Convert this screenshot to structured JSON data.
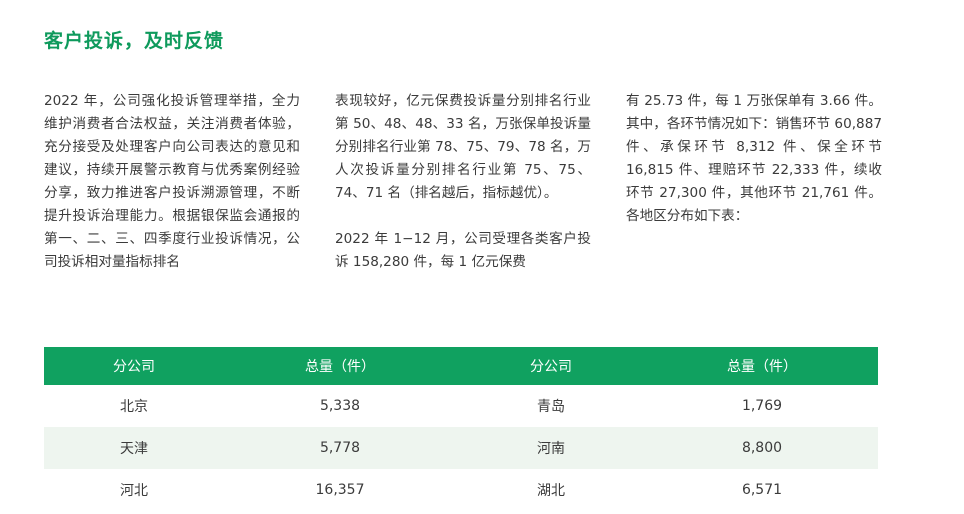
{
  "heading": "客户投诉，及时反馈",
  "columns": {
    "col1": "2022 年，公司强化投诉管理举措，全力维护消费者合法权益，关注消费者体验，充分接受及处理客户向公司表达的意见和建议，持续开展警示教育与优秀案例经验分享，致力推进客户投诉溯源管理，不断提升投诉治理能力。根据银保监会通报的第一、二、三、四季度行业投诉情况，公司投诉相对量指标排名",
    "col2_p1": "表现较好，亿元保费投诉量分别排名行业第 50、48、48、33 名，万张保单投诉量分别排名行业第 78、75、79、78 名，万人次投诉量分别排名行业第 75、75、74、71 名（排名越后，指标越优）。",
    "col2_p2": "2022 年 1−12 月，公司受理各类客户投诉 158,280 件，每 1 亿元保费",
    "col3": "有 25.73 件，每 1 万张保单有 3.66 件。其中，各环节情况如下：销售环节 60,887 件、承保环节 8,312 件、保全环节 16,815 件、理赔环节 22,333 件，续收环节 27,300 件，其他环节 21,761 件。各地区分布如下表："
  },
  "table": {
    "headers": [
      "分公司",
      "总量（件）",
      "分公司",
      "总量（件）"
    ],
    "rows": [
      [
        "北京",
        "5,338",
        "青岛",
        "1,769"
      ],
      [
        "天津",
        "5,778",
        "河南",
        "8,800"
      ],
      [
        "河北",
        "16,357",
        "湖北",
        "6,571"
      ]
    ]
  }
}
